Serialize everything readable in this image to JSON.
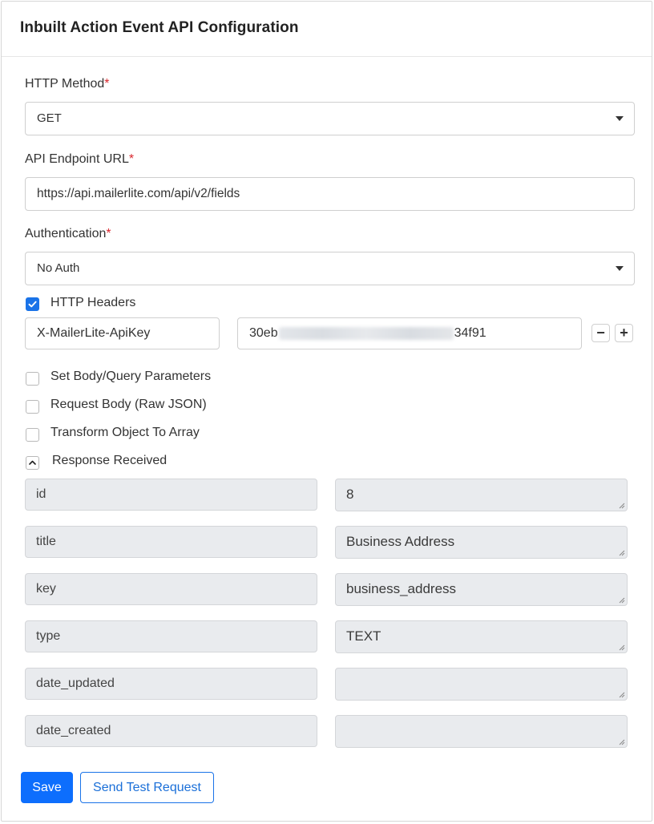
{
  "panel": {
    "title": "Inbuilt Action Event API Configuration"
  },
  "http_method": {
    "label": "HTTP Method",
    "required_mark": "*",
    "value": "GET",
    "icon": "chevron-down-icon"
  },
  "endpoint": {
    "label": "API Endpoint URL",
    "required_mark": "*",
    "value": "https://api.mailerlite.com/api/v2/fields"
  },
  "authentication": {
    "label": "Authentication",
    "required_mark": "*",
    "value": "No Auth",
    "icon": "chevron-down-icon"
  },
  "http_headers": {
    "label": "HTTP Headers",
    "checked": true,
    "rows": [
      {
        "key": "X-MailerLite-ApiKey",
        "value_prefix": "30eb",
        "value_suffix": "34f91"
      }
    ],
    "remove_label": "−",
    "add_label": "+"
  },
  "options": [
    {
      "label": "Set Body/Query Parameters",
      "checked": false
    },
    {
      "label": "Request Body (Raw JSON)",
      "checked": false
    },
    {
      "label": "Transform Object To Array",
      "checked": false
    }
  ],
  "response": {
    "label": "Response Received",
    "icon": "chevron-up-icon",
    "rows": [
      {
        "key": "id",
        "value": "8"
      },
      {
        "key": "title",
        "value": "Business Address"
      },
      {
        "key": "key",
        "value": "business_address"
      },
      {
        "key": "type",
        "value": "TEXT"
      },
      {
        "key": "date_updated",
        "value": ""
      },
      {
        "key": "date_created",
        "value": ""
      }
    ]
  },
  "actions": {
    "save_label": "Save",
    "test_label": "Send Test Request"
  },
  "colors": {
    "primary": "#0d6efd",
    "required": "#d9272e",
    "readonly_bg": "#e9ebee"
  }
}
